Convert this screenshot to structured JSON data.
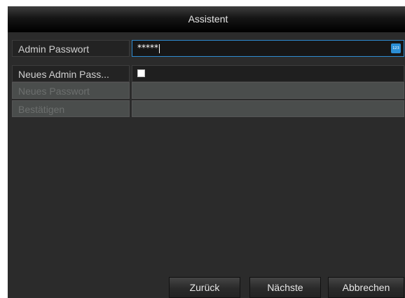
{
  "dialog": {
    "title": "Assistent"
  },
  "form": {
    "admin_password": {
      "label": "Admin Passwort",
      "value": "*****",
      "keyboard_badge": "123"
    },
    "new_admin_password": {
      "label": "Neues Admin Pass...",
      "checked": false
    },
    "new_password": {
      "label": "Neues Passwort",
      "value": ""
    },
    "confirm": {
      "label": "Bestätigen",
      "value": ""
    }
  },
  "buttons": {
    "back": "Zurück",
    "next": "Nächste",
    "cancel": "Abbrechen"
  },
  "colors": {
    "focus_border": "#2e8bd0",
    "dialog_bg": "#2b2b2b",
    "disabled_row": "#4a4d4c"
  }
}
